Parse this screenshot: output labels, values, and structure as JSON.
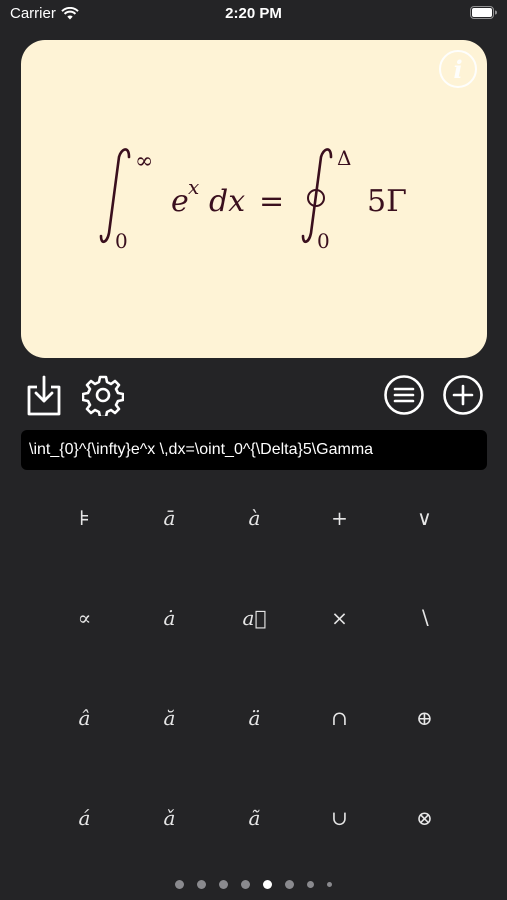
{
  "status_bar": {
    "carrier": "Carrier",
    "time": "2:20 PM",
    "icons": [
      "wifi-icon",
      "battery-icon"
    ]
  },
  "preview": {
    "background": "#fef3d6",
    "ink": "#3a0f1e",
    "info_icon": "i",
    "formula": {
      "lower_limit_1": "0",
      "upper_limit_1": "∞",
      "base": "e",
      "exponent": "x",
      "differential": "dx",
      "equals": "=",
      "lower_limit_2": "0",
      "upper_limit_2": "Δ",
      "rhs": "5Γ"
    }
  },
  "toolbar": {
    "icons": [
      "download-icon",
      "gear-icon",
      "list-icon",
      "add-icon"
    ]
  },
  "latex_input": {
    "value": "\\int_{0}^{\\infty}e^x \\,dx=\\oint_0^{\\Delta}5\\Gamma"
  },
  "symbols": [
    {
      "label": "⊧",
      "italic": false
    },
    {
      "label": "ā",
      "italic": true
    },
    {
      "label": "à",
      "italic": true
    },
    {
      "label": "+",
      "italic": false
    },
    {
      "label": "∨",
      "italic": false
    },
    {
      "label": "∝",
      "italic": false
    },
    {
      "label": "ȧ",
      "italic": true
    },
    {
      "label": "a⃗",
      "italic": true
    },
    {
      "label": "×",
      "italic": false
    },
    {
      "label": "∖",
      "italic": false
    },
    {
      "label": "â",
      "italic": true
    },
    {
      "label": "ă",
      "italic": true
    },
    {
      "label": "ä",
      "italic": true
    },
    {
      "label": "∩",
      "italic": false
    },
    {
      "label": "⊕",
      "italic": false
    },
    {
      "label": "á",
      "italic": true
    },
    {
      "label": "ǎ",
      "italic": true
    },
    {
      "label": "ã",
      "italic": true
    },
    {
      "label": "∪",
      "italic": false
    },
    {
      "label": "⊗",
      "italic": false
    }
  ],
  "pagination": {
    "count": 8,
    "active_index": 4
  },
  "colors": {
    "background": "#242426",
    "accent": "#ffffff"
  }
}
